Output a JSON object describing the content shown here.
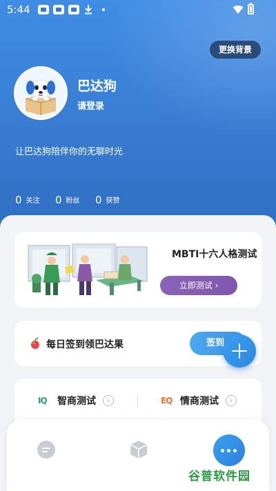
{
  "status_bar": {
    "time": "5:44",
    "icons": [
      "app-notification-icon",
      "app-notification-icon",
      "app-notification-icon",
      "download-icon",
      "dot-icon",
      "wifi-icon",
      "battery-icon"
    ]
  },
  "profile": {
    "change_background_label": "更换背景",
    "username": "巴达狗",
    "login_label": "请登录",
    "slogan": "让巴达狗陪伴你的无聊时光",
    "stats": [
      {
        "count": "0",
        "label": "关注"
      },
      {
        "count": "0",
        "label": "粉丝"
      },
      {
        "count": "0",
        "label": "获赞"
      }
    ]
  },
  "mbti": {
    "title": "MBTI十六人格测试",
    "button_label": "立即测试 ›"
  },
  "checkin": {
    "text": "每日签到领巴达果",
    "button_label": "签到"
  },
  "tests": [
    {
      "badge": "IQ",
      "label": "智商测试",
      "badge_color": "#2aa07a"
    },
    {
      "badge": "EQ",
      "label": "情商测试",
      "badge_color": "#e8742f"
    }
  ],
  "tab_bar": {
    "icons": [
      "home-icon",
      "box-icon",
      "chat-icon"
    ]
  },
  "watermark": "谷普软件园",
  "colors": {
    "hero_blue": "#3a7fd6",
    "accent_blue": "#3d92e6",
    "mbti_purple": "#8a63b6",
    "watermark_green": "#2a9a44"
  }
}
